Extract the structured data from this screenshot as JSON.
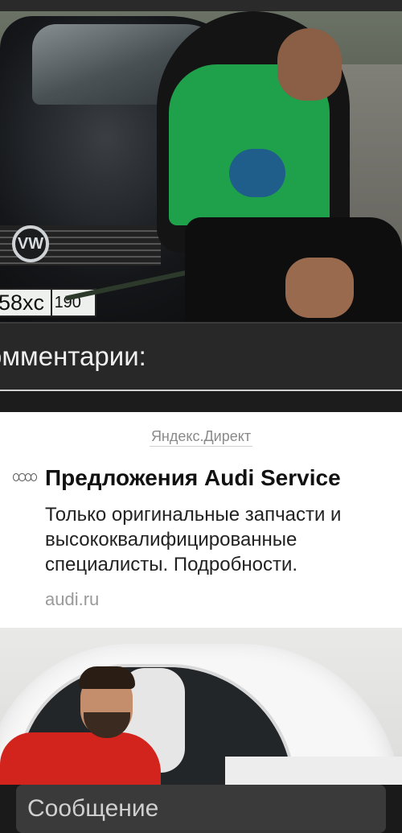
{
  "photo": {
    "plate_number": "58xc",
    "plate_region": "190",
    "emblem_text": "VW"
  },
  "comments": {
    "title": "омментарии:"
  },
  "ad": {
    "source": "Яндекс.Директ",
    "title": "Предложения Audi Service",
    "text": "Только оригинальные запчасти и высококвалифицированные специалисты. Подробности.",
    "domain": "audi.ru"
  },
  "message": {
    "placeholder": "Сообщение"
  }
}
